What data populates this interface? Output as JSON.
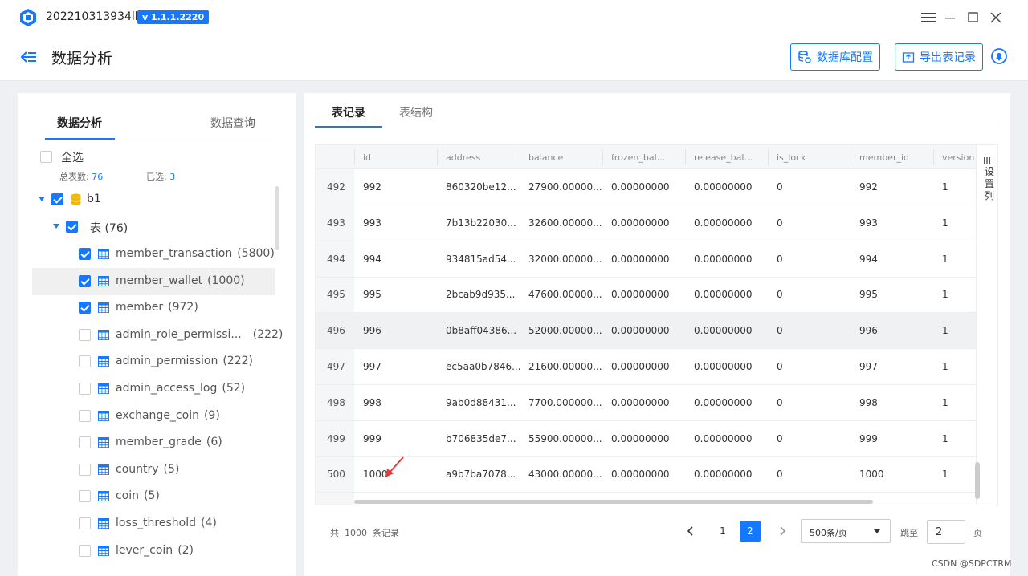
{
  "window": {
    "title": "202210313934lll2",
    "version": "v 1.1.1.2220"
  },
  "header": {
    "title": "数据分析",
    "db_config_label": "数据库配置",
    "export_label": "导出表记录"
  },
  "left": {
    "tabs": [
      "数据分析",
      "数据查询"
    ],
    "select_all": "全选",
    "total_label": "总表数:",
    "total_value": "76",
    "selected_label": "已选:",
    "selected_value": "3",
    "db": {
      "name": "b1",
      "checked": true
    },
    "tables_group": {
      "label": "表",
      "count": "(76)"
    },
    "tables": [
      {
        "name": "member_transaction",
        "count": "(5800)",
        "checked": true
      },
      {
        "name": "member_wallet",
        "count": "(1000)",
        "checked": true
      },
      {
        "name": "member",
        "count": "(972)",
        "checked": true
      },
      {
        "name": "admin_role_permissi...",
        "count": "(222)",
        "checked": false
      },
      {
        "name": "admin_permission",
        "count": "(222)",
        "checked": false
      },
      {
        "name": "admin_access_log",
        "count": "(52)",
        "checked": false
      },
      {
        "name": "exchange_coin",
        "count": "(9)",
        "checked": false
      },
      {
        "name": "member_grade",
        "count": "(6)",
        "checked": false
      },
      {
        "name": "country",
        "count": "(5)",
        "checked": false
      },
      {
        "name": "coin",
        "count": "(5)",
        "checked": false
      },
      {
        "name": "loss_threshold",
        "count": "(4)",
        "checked": false
      },
      {
        "name": "lever_coin",
        "count": "(2)",
        "checked": false
      }
    ]
  },
  "main": {
    "tabs": [
      "表记录",
      "表结构"
    ],
    "columns": [
      "id",
      "address",
      "balance",
      "frozen_bal...",
      "release_bal...",
      "is_lock",
      "member_id",
      "version"
    ],
    "rows": [
      [
        "492",
        "992",
        "860320be12...",
        "27900.00000...",
        "0.00000000",
        "0.00000000",
        "0",
        "992",
        "1"
      ],
      [
        "493",
        "993",
        "7b13b22030...",
        "32600.00000...",
        "0.00000000",
        "0.00000000",
        "0",
        "993",
        "1"
      ],
      [
        "494",
        "994",
        "934815ad54...",
        "32000.00000...",
        "0.00000000",
        "0.00000000",
        "0",
        "994",
        "1"
      ],
      [
        "495",
        "995",
        "2bcab9d935...",
        "47600.00000...",
        "0.00000000",
        "0.00000000",
        "0",
        "995",
        "1"
      ],
      [
        "496",
        "996",
        "0b8aff04386...",
        "52000.00000...",
        "0.00000000",
        "0.00000000",
        "0",
        "996",
        "1"
      ],
      [
        "497",
        "997",
        "ec5aa0b7846...",
        "21600.00000...",
        "0.00000000",
        "0.00000000",
        "0",
        "997",
        "1"
      ],
      [
        "498",
        "998",
        "9ab0d88431...",
        "7700.000000...",
        "0.00000000",
        "0.00000000",
        "0",
        "998",
        "1"
      ],
      [
        "499",
        "999",
        "b706835de7...",
        "55900.00000...",
        "0.00000000",
        "0.00000000",
        "0",
        "999",
        "1"
      ],
      [
        "500",
        "1000",
        "a9b7ba7078...",
        "43000.00000...",
        "0.00000000",
        "0.00000000",
        "0",
        "1000",
        "1"
      ]
    ],
    "settings_label": "设置列",
    "pager": {
      "total_prefix": "共",
      "total_value": "1000",
      "total_suffix": "条记录",
      "pages": [
        "1",
        "2"
      ],
      "page_size": "500条/页",
      "jump_label": "跳至",
      "jump_value": "2",
      "page_suffix": "页"
    }
  },
  "watermark": "CSDN @SDPCTRM",
  "colors": {
    "accent": "#1677ff",
    "arrow": "#e53935"
  }
}
